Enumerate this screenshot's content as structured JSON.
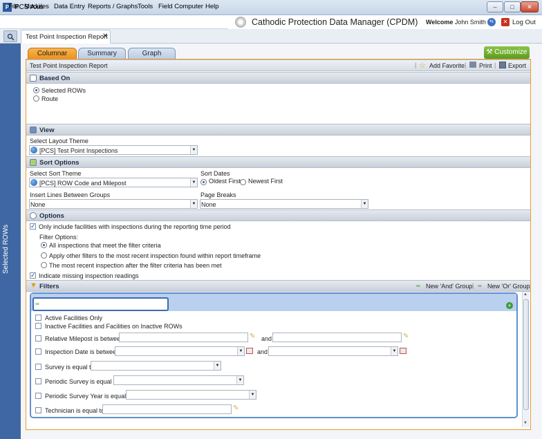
{
  "window": {
    "app_title": "PCS Axis",
    "min": "–",
    "max": "□",
    "close": "✕"
  },
  "menu": [
    "File",
    "Modules",
    "Data Entry",
    "Reports / Graphs",
    "Tools",
    "Field Computer",
    "Help"
  ],
  "banner": {
    "title": "Cathodic Protection Data Manager (CPDM)",
    "welcome_label": "Welcome",
    "user": "John Smith",
    "logout": "Log Out"
  },
  "doc_tab": {
    "label": "Test Point Inspection Report",
    "close": "✕"
  },
  "sidebar": {
    "label": "Selected ROWs"
  },
  "report_tabs": [
    "Columnar",
    "Summary",
    "Graph"
  ],
  "customize": "Customize",
  "report": {
    "title": "Test Point Inspection Report",
    "add_favorite": "Add Favorite",
    "print": "Print",
    "export": "Export"
  },
  "based_on": {
    "header": "Based On",
    "options": [
      "Selected ROWs",
      "Route"
    ]
  },
  "view": {
    "header": "View",
    "layout_label": "Select Layout Theme",
    "layout_value": "[PCS] Test Point Inspections"
  },
  "sort": {
    "header": "Sort Options",
    "sort_theme_label": "Select Sort Theme",
    "sort_theme_value": "[PCS] ROW Code and Milepost",
    "sort_dates_label": "Sort Dates",
    "oldest": "Oldest First",
    "newest": "Newest First",
    "insert_lines_label": "Insert Lines Between Groups",
    "insert_lines_value": "None",
    "page_breaks_label": "Page Breaks",
    "page_breaks_value": "None"
  },
  "options": {
    "header": "Options",
    "only_include": "Only include facilities with inspections during the reporting time period",
    "filter_options_label": "Filter Options:",
    "filter_opts": [
      "All inspections that meet the filter criteria",
      "Apply other filters to the most recent inspection found within report timeframe",
      "The most recent inspection after the filter criteria has been met"
    ],
    "indicate_missing": "Indicate missing inspection readings"
  },
  "filters": {
    "header": "Filters",
    "new_and": "New 'And' Group",
    "new_or": "New 'Or' Group",
    "rows": {
      "active": "Active Facilities Only",
      "inactive": "Inactive Facilities and Facilities on Inactive ROWs",
      "milepost": "Relative Milepost is between",
      "and1": "and",
      "inspection_date": "Inspection Date is between",
      "and2": "and",
      "survey": "Survey is equal to",
      "periodic_survey": "Periodic Survey is equal to",
      "periodic_year": "Periodic Survey Year is equal to",
      "technician": "Technician is equal to"
    }
  },
  "colors": {
    "accent_orange": "#ec8f1a",
    "sidebar_blue": "#3f67a3",
    "customize_green": "#5b9b1d"
  }
}
